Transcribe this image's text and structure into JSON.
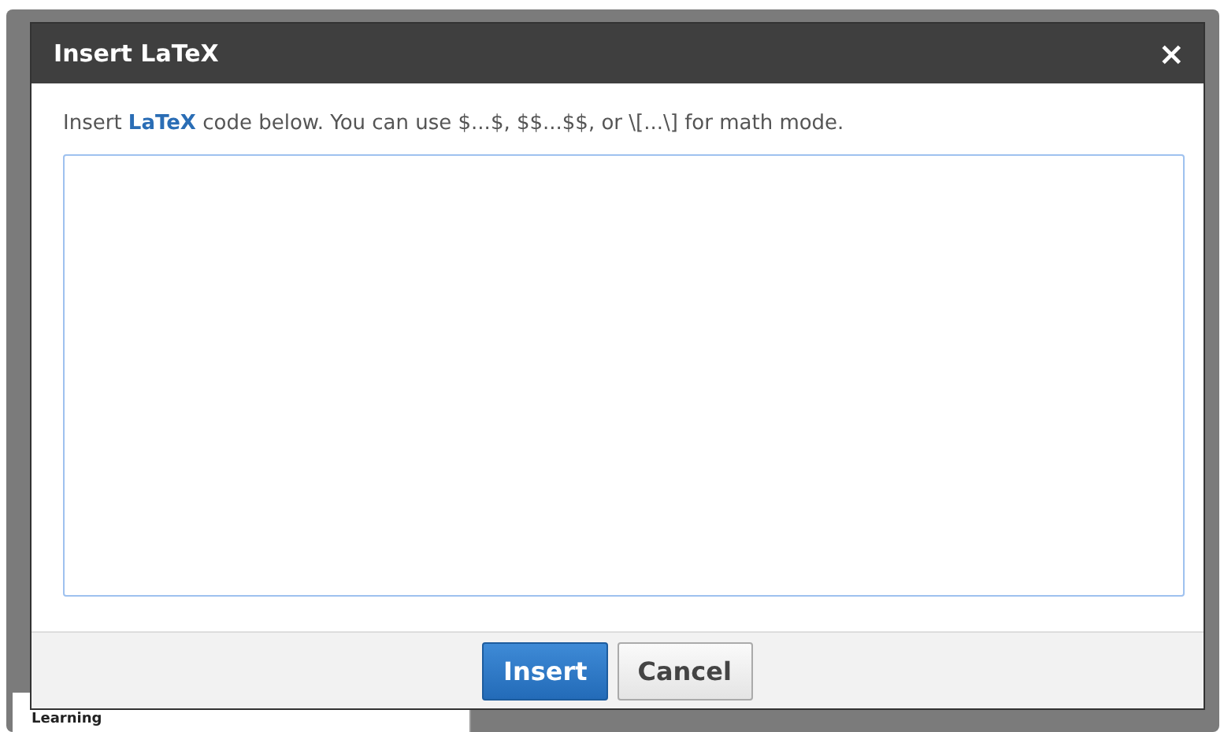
{
  "dialog": {
    "title": "Insert LaTeX",
    "close": "×",
    "description": "Insert **LaTeX** code below. You can use $...$, $$...$$, or \\[...\\] for math mode.",
    "buttons": [
      {
        "label": "Insert",
        "kind": "primary"
      },
      {
        "label": "Cancel",
        "kind": "secondary"
      }
    ]
  },
  "background": {
    "text": "Learning"
  }
}
